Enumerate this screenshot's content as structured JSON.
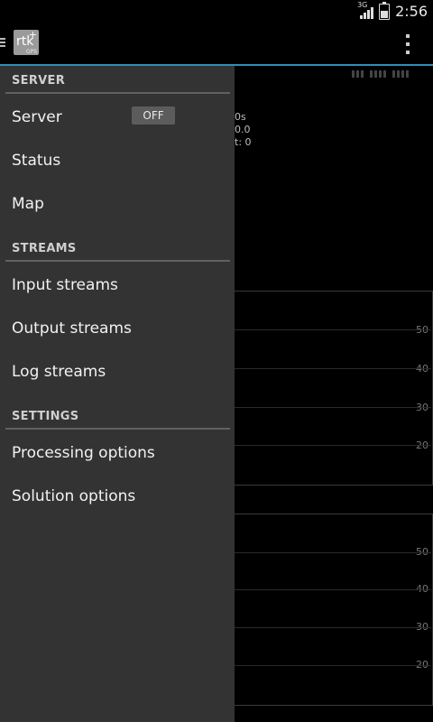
{
  "statusbar": {
    "time": "2:56",
    "network_label": "3G"
  },
  "actionbar": {
    "logo_main": "rtk",
    "logo_plus": "+",
    "logo_sub": "GPS"
  },
  "background": {
    "stats": [
      "0s",
      "0.0",
      "t: 0"
    ],
    "plot1_ticks": [
      "50",
      "40",
      "30",
      "20"
    ],
    "plot2_ticks": [
      "50",
      "40",
      "30",
      "20"
    ]
  },
  "drawer": {
    "sections": [
      {
        "header": "SERVER"
      },
      {
        "header": "STREAMS"
      },
      {
        "header": "SETTINGS"
      }
    ],
    "items": {
      "server": "Server",
      "server_toggle": "OFF",
      "status": "Status",
      "map": "Map",
      "input_streams": "Input streams",
      "output_streams": "Output streams",
      "log_streams": "Log streams",
      "processing_options": "Processing options",
      "solution_options": "Solution options"
    }
  },
  "colors": {
    "accent_line": "#2f8fb6",
    "drawer_bg": "#333333",
    "divider": "#616161"
  }
}
